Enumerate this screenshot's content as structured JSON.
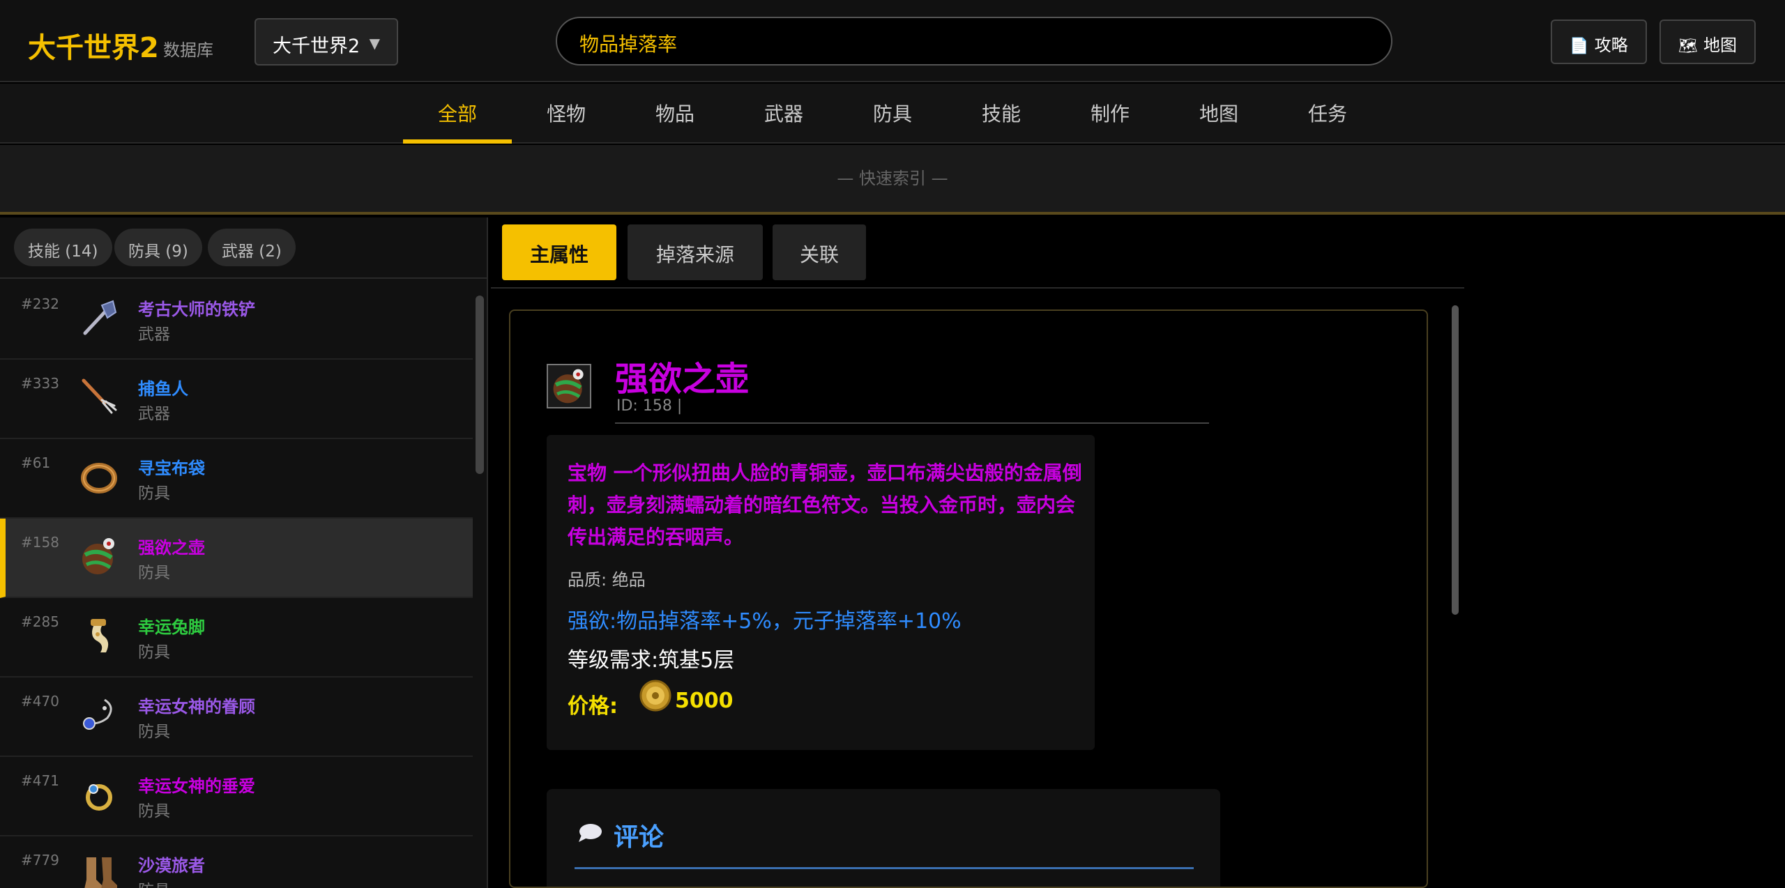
{
  "header": {
    "logo": "大千世界2",
    "logo_sub": "数据库",
    "game_select": "大千世界2",
    "search_value": "物品掉落率",
    "buttons": [
      {
        "icon": "document-icon",
        "glyph": "📄",
        "label": "攻略"
      },
      {
        "icon": "map-icon",
        "glyph": "🗺",
        "label": "地图"
      }
    ]
  },
  "nav": {
    "tabs": [
      "全部",
      "怪物",
      "物品",
      "武器",
      "防具",
      "技能",
      "制作",
      "地图",
      "任务"
    ],
    "active": "全部"
  },
  "quick_index": "— 快速索引 —",
  "sidebar": {
    "filters": [
      "技能 (14)",
      "防具 (9)",
      "武器 (2)"
    ],
    "items": [
      {
        "num": "#232",
        "name": "考古大师的铁铲",
        "type": "武器",
        "color": "#9b59e8"
      },
      {
        "num": "#333",
        "name": "捕鱼人",
        "type": "武器",
        "color": "#2f8cff"
      },
      {
        "num": "#61",
        "name": "寻宝布袋",
        "type": "防具",
        "color": "#2f8cff"
      },
      {
        "num": "#158",
        "name": "强欲之壶",
        "type": "防具",
        "color": "#c800e0"
      },
      {
        "num": "#285",
        "name": "幸运兔脚",
        "type": "防具",
        "color": "#2ecc40"
      },
      {
        "num": "#470",
        "name": "幸运女神的眷顾",
        "type": "防具",
        "color": "#9b59e8"
      },
      {
        "num": "#471",
        "name": "幸运女神的垂爱",
        "type": "防具",
        "color": "#c800e0"
      },
      {
        "num": "#779",
        "name": "沙漠旅者",
        "type": "防具",
        "color": "#9b59e8"
      }
    ],
    "active_index": 3
  },
  "content": {
    "tabs": [
      "主属性",
      "掉落来源",
      "关联"
    ],
    "active_tab": "主属性",
    "detail": {
      "name": "强欲之壶",
      "id_line": "ID: 158 |",
      "description": "宝物 一个形似扭曲人脸的青铜壶，壶口布满尖齿般的金属倒刺，壶身刻满蠕动着的暗红色符文。当投入金币时，壶内会传出满足的吞咽声。",
      "quality": "品质: 绝品",
      "effect": "强欲:物品掉落率+5%，元子掉落率+10%",
      "requirement": "等级需求:筑基5层",
      "price_label": "价格:",
      "price": "5000"
    },
    "comments_title": "评论"
  },
  "colors": {
    "accent": "#f5c000",
    "legendary": "#c800e0",
    "epic": "#9b59e8",
    "rare": "#2f8cff",
    "uncommon": "#2ecc40"
  }
}
